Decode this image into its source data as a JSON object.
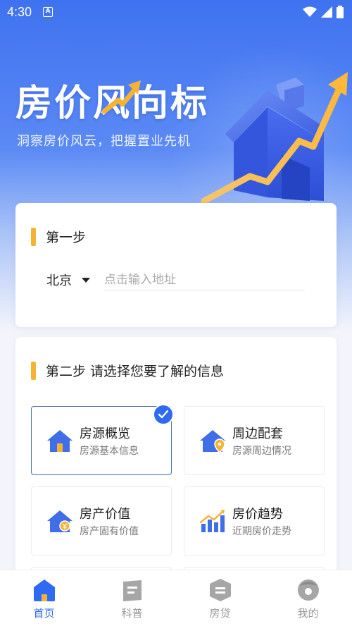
{
  "status_bar": {
    "time": "4:30",
    "notif_icon": "a-icon"
  },
  "hero": {
    "title": "房价风向标",
    "subtitle": "洞察房价风云，把握置业先机"
  },
  "step1": {
    "title": "第一步",
    "city": "北京",
    "address_placeholder": "点击输入地址",
    "address_value": ""
  },
  "step2": {
    "title": "第二步 请选择您要了解的信息",
    "options": [
      {
        "title": "房源概览",
        "subtitle": "房源基本信息",
        "icon": "house-icon",
        "selected": true
      },
      {
        "title": "周边配套",
        "subtitle": "房源周边情况",
        "icon": "house-location-icon",
        "selected": false
      },
      {
        "title": "房产价值",
        "subtitle": "房产固有价值",
        "icon": "house-value-icon",
        "selected": false
      },
      {
        "title": "房价趋势",
        "subtitle": "近期房价走势",
        "icon": "trend-chart-icon",
        "selected": false
      }
    ]
  },
  "bottom_nav": [
    {
      "label": "首页",
      "icon": "home-icon",
      "active": true
    },
    {
      "label": "科普",
      "icon": "book-icon",
      "active": false
    },
    {
      "label": "房贷",
      "icon": "loan-icon",
      "active": false
    },
    {
      "label": "我的",
      "icon": "profile-icon",
      "active": false
    }
  ],
  "colors": {
    "primary": "#2f6af2",
    "accent": "#f5b335",
    "icon_blue": "#3f6ee6"
  }
}
